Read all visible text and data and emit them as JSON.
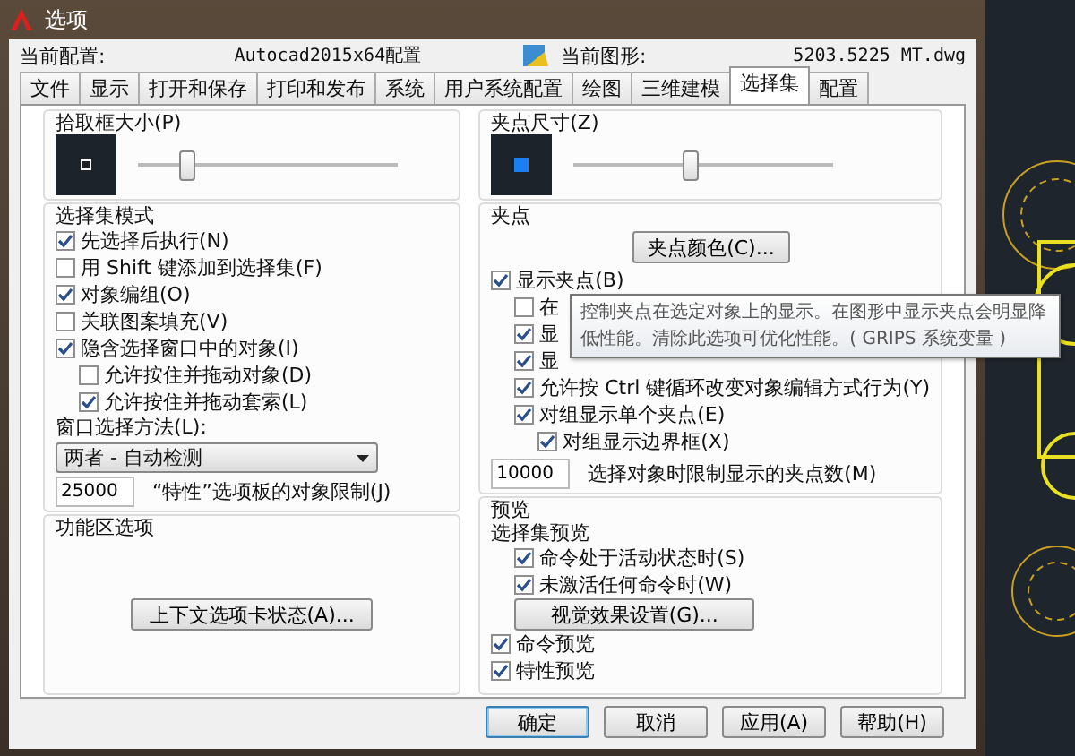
{
  "window": {
    "title": "选项"
  },
  "header": {
    "profile_label": "当前配置:",
    "profile": "Autocad2015x64配置",
    "drawing_label": "当前图形:",
    "drawing": "5203.5225 MT.dwg"
  },
  "tabs": [
    {
      "label": "文件",
      "selected": false
    },
    {
      "label": "显示",
      "selected": false
    },
    {
      "label": "打开和保存",
      "selected": false
    },
    {
      "label": "打印和发布",
      "selected": false
    },
    {
      "label": "系统",
      "selected": false
    },
    {
      "label": "用户系统配置",
      "selected": false
    },
    {
      "label": "绘图",
      "selected": false
    },
    {
      "label": "三维建模",
      "selected": false
    },
    {
      "label": "选择集",
      "selected": true
    },
    {
      "label": "配置",
      "selected": false
    }
  ],
  "pickbox": {
    "title": "拾取框大小(P)",
    "level": 0.17
  },
  "selection_modes": {
    "title": "选择集模式",
    "options": [
      {
        "label": "先选择后执行(N)",
        "checked": true
      },
      {
        "label": "用 Shift 键添加到选择集(F)",
        "checked": false
      },
      {
        "label": "对象编组(O)",
        "checked": true
      },
      {
        "label": "关联图案填充(V)",
        "checked": false
      },
      {
        "label": "隐含选择窗口中的对象(I)",
        "checked": true,
        "children": [
          {
            "label": "允许按住并拖动对象(D)",
            "checked": false
          },
          {
            "label": "允许按住并拖动套索(L)",
            "checked": true
          }
        ]
      }
    ]
  },
  "window_method": {
    "label": "窗口选择方法(L):",
    "value": "两者 - 自动检测"
  },
  "object_limit": {
    "value": "25000",
    "label": "“特性”选项板的对象限制(J)"
  },
  "ribbon": {
    "title": "功能区选项",
    "button": "上下文选项卡状态(A)..."
  },
  "grip_size": {
    "title": "夹点尺寸(Z)",
    "level": 0.45
  },
  "grips": {
    "title": "夹点",
    "button": "夹点颜色(C)...",
    "options": [
      {
        "label": "显示夹点(B)",
        "checked": true,
        "children": [
          {
            "label": "在",
            "checked": false
          },
          {
            "label": "显",
            "checked": true
          },
          {
            "label": "显",
            "checked": true
          },
          {
            "label": "允许按 Ctrl 键循环改变对象编辑方式行为(Y)",
            "checked": true
          },
          {
            "label": "对组显示单个夹点(E)",
            "checked": true,
            "children": [
              {
                "label": "对组显示边界框(X)",
                "checked": true
              }
            ]
          }
        ]
      }
    ],
    "limit": {
      "value": "10000",
      "label": "选择对象时限制显示的夹点数(M)"
    }
  },
  "preview": {
    "title": "预览",
    "subtitle": "选择集预览",
    "options": [
      {
        "label": "命令处于活动状态时(S)",
        "checked": true
      },
      {
        "label": "未激活任何命令时(W)",
        "checked": true
      }
    ],
    "button": "视觉效果设置(G)...",
    "more_options": [
      {
        "label": "命令预览",
        "checked": true
      },
      {
        "label": "特性预览",
        "checked": true
      }
    ]
  },
  "tooltip": {
    "text": "控制夹点在选定对象上的显示。在图形中显示夹点会明显降低性能。清除此选项可优化性能。( GRIPS 系统变量 )"
  },
  "buttons": [
    {
      "label": "确定",
      "default": true
    },
    {
      "label": "取消",
      "default": false
    },
    {
      "label": "应用(A)",
      "default": false
    },
    {
      "label": "帮助(H)",
      "default": false
    }
  ]
}
